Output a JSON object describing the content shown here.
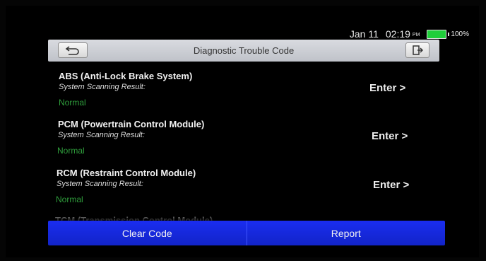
{
  "status": {
    "date": "Jan 11",
    "time": "02:19",
    "ampm": "PM",
    "battery": "100%",
    "battery_color": "#1fcf3a"
  },
  "header": {
    "title": "Diagnostic Trouble Code",
    "back_icon": "back-arrow-icon",
    "exit_icon": "exit-icon"
  },
  "modules": [
    {
      "name": "ABS (Anti-Lock Brake System)",
      "subtitle": "System Scanning Result:",
      "result": "Normal",
      "action": "Enter >"
    },
    {
      "name": "PCM (Powertrain Control Module)",
      "subtitle": "System Scanning Result:",
      "result": "Normal",
      "action": "Enter >"
    },
    {
      "name": "RCM (Restraint Control Module)",
      "subtitle": "System Scanning Result:",
      "result": "Normal",
      "action": "Enter >"
    },
    {
      "name": "TCM (Transmission Control Module)"
    }
  ],
  "footer": {
    "clear_label": "Clear Code",
    "report_label": "Report",
    "accent": "#1a2df0"
  },
  "colors": {
    "result_ok": "#2f9e3c",
    "background": "#000000"
  }
}
